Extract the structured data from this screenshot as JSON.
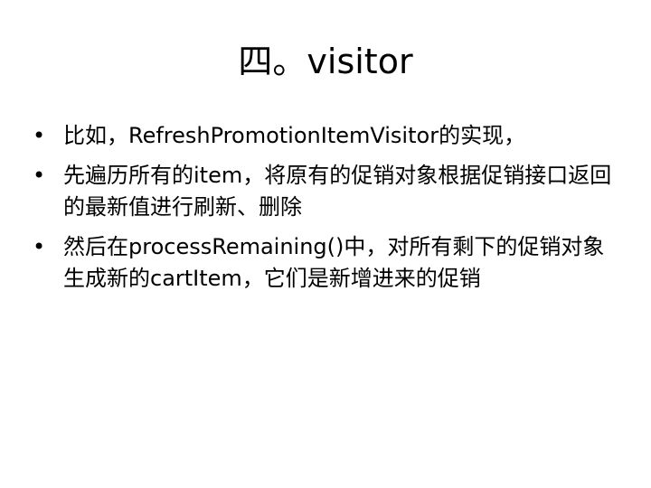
{
  "slide": {
    "title": "四。visitor",
    "bullet_symbol": "•",
    "bullets": [
      {
        "text": "比如，RefreshPromotionItemVisitor的实现，"
      },
      {
        "text": "先遍历所有的item，将原有的促销对象根据促销接口返回的最新值进行刷新、删除"
      },
      {
        "text": "然后在processRemaining()中，对所有剩下的促销对象生成新的cartItem，它们是新增进来的促销"
      }
    ]
  }
}
